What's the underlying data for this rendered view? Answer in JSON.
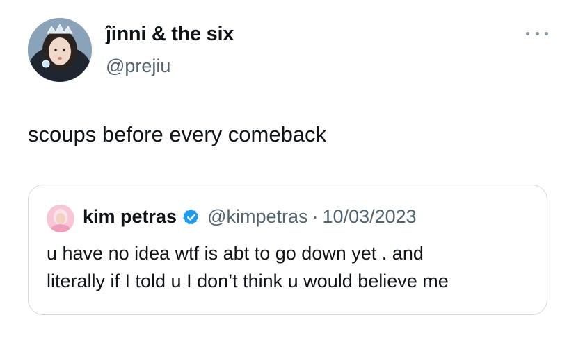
{
  "tweet": {
    "author": {
      "display_name": "ĵinni & the six",
      "handle": "@prejiu",
      "avatar": "profile-photo"
    },
    "more_icon": "more-horizontal-icon",
    "text": "scoups before every comeback"
  },
  "quoted_tweet": {
    "author": {
      "display_name": "kim petras",
      "handle": "@kimpetras",
      "verified": true,
      "verified_icon": "verified-badge-icon",
      "avatar": "profile-photo"
    },
    "separator": "·",
    "date": "10/03/2023",
    "text_lines": [
      "u have no idea wtf is abt to go down yet . and",
      "literally if I told u I don’t think u would believe me"
    ]
  },
  "colors": {
    "primary_text": "#0f1419",
    "secondary_text": "#536471",
    "border": "#cfd9de",
    "verified_blue": "#1d9bf0"
  }
}
